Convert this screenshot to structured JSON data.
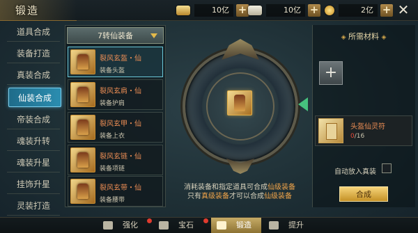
{
  "header": {
    "title": "锻造"
  },
  "resources": [
    {
      "icon": "gold-ingot-icon",
      "value": "10亿"
    },
    {
      "icon": "silver-ingot-icon",
      "value": "10亿"
    },
    {
      "icon": "coin-icon",
      "value": "2亿"
    }
  ],
  "left_tabs": [
    {
      "label": "道具合成"
    },
    {
      "label": "装备打造"
    },
    {
      "label": "真装合成"
    },
    {
      "label": "仙装合成",
      "active": true
    },
    {
      "label": "帝装合成"
    },
    {
      "label": "魂装升转"
    },
    {
      "label": "魂装升星"
    },
    {
      "label": "挂饰升星"
    },
    {
      "label": "灵装打造"
    }
  ],
  "equipment_list": {
    "dropdown_label": "7转仙装备",
    "items": [
      {
        "name": "裂风玄盔・仙",
        "type": "装备头盔",
        "selected": true
      },
      {
        "name": "裂风玄肩・仙",
        "type": "装备护肩"
      },
      {
        "name": "裂风玄甲・仙",
        "type": "装备上衣"
      },
      {
        "name": "裂风玄链・仙",
        "type": "装备项链"
      },
      {
        "name": "裂风玄带・仙",
        "type": "装备腰带"
      }
    ]
  },
  "hint": {
    "line1_prefix": "消耗装备和指定道具可合成",
    "line1_highlight": "仙级装备",
    "line2_prefix": "只有",
    "line2_highlight1": "真级装备",
    "line2_mid": "才可以合成",
    "line2_highlight2": "仙级装备"
  },
  "materials": {
    "title": "所需材料",
    "add_label": "+",
    "item": {
      "name": "头盔仙灵符",
      "current": "0",
      "total": "/16"
    },
    "auto_label": "自动放入真装",
    "craft_label": "合成"
  },
  "bottom_nav": [
    {
      "label": "强化",
      "icon": "enhance-icon",
      "notify": true
    },
    {
      "label": "宝石",
      "icon": "gem-icon",
      "notify": true
    },
    {
      "label": "锻造",
      "icon": "forge-icon",
      "active": true
    },
    {
      "label": "提升",
      "icon": "upgrade-icon"
    }
  ],
  "colors": {
    "accent_orange": "#ef8f55",
    "active_tab": "#2b8db0",
    "gold_button": "#e0b04a",
    "arrow_green": "#46c27e"
  }
}
